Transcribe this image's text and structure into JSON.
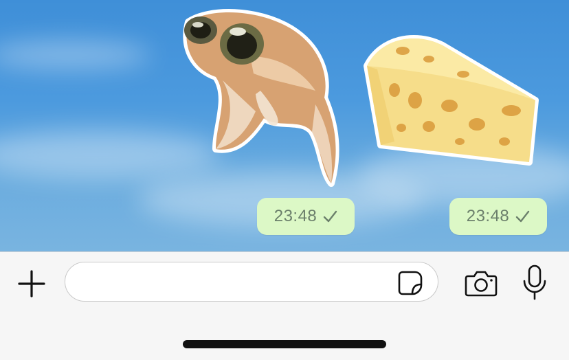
{
  "messages": [
    {
      "sticker_icon": "goldfish-sticker",
      "time": "23:48",
      "status_icon": "sent-check-icon"
    },
    {
      "sticker_icon": "cheese-sticker",
      "time": "23:48",
      "status_icon": "sent-check-icon"
    }
  ],
  "composer": {
    "value": "",
    "placeholder": "",
    "plus_icon": "plus-icon",
    "sticker_icon": "sticker-icon",
    "camera_icon": "camera-icon",
    "mic_icon": "microphone-icon"
  },
  "colors": {
    "bubble": "#dcf8c6",
    "time_text": "#6b7f6b",
    "sky": "#4c9ade",
    "input_bar": "#f6f6f6"
  }
}
